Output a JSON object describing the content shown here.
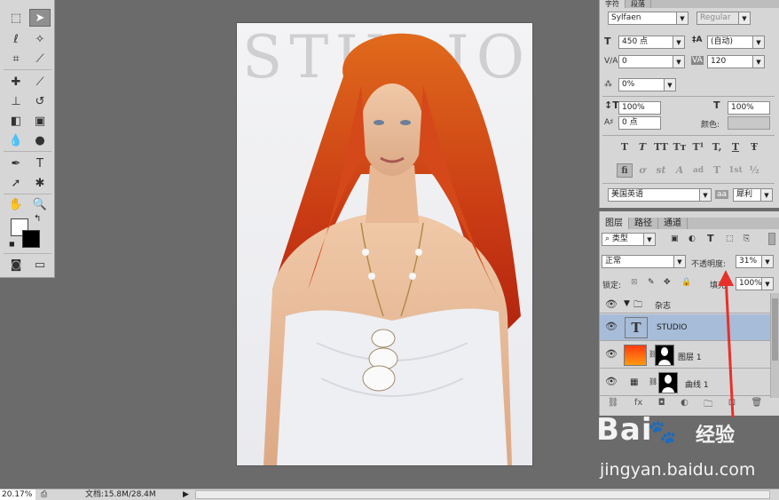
{
  "toolbox": {
    "tools": [
      "marquee-tool",
      "move-tool",
      "lasso-tool",
      "quick-select-tool",
      "crop-tool",
      "eyedropper-tool",
      "healing-tool",
      "brush-tool",
      "stamp-tool",
      "history-brush-tool",
      "eraser-tool",
      "gradient-tool",
      "blur-tool",
      "dodge-tool",
      "pen-tool",
      "type-tool",
      "path-select-tool",
      "shape-tool",
      "hand-tool",
      "zoom-tool"
    ],
    "active_tool": "move-tool",
    "foreground_color": "#ffffff",
    "background_color": "#000000"
  },
  "document": {
    "watermark_text": "STUDIO"
  },
  "character_panel": {
    "tabs": [
      "字符",
      "段落"
    ],
    "font_family": "Sylfaen",
    "font_style": "Regular",
    "font_size": "450 点",
    "leading": "(自动)",
    "kerning": "0",
    "tracking": "120",
    "tsume": "0%",
    "vertical_scale": "100%",
    "horizontal_scale": "100%",
    "baseline_shift": "0 点",
    "color_label": "颜色:",
    "style_buttons": [
      "T",
      "T",
      "TT",
      "Tт",
      "T¹",
      "T,",
      "T",
      "Ŧ"
    ],
    "opentype_buttons": [
      "fi",
      "ơ",
      "st",
      "A",
      "ad",
      "T",
      "1st",
      "½"
    ],
    "language": "美国英语",
    "aa_icon": "aa",
    "antialias": "犀利"
  },
  "layers_panel": {
    "tabs": [
      "图层",
      "路径",
      "通道"
    ],
    "filter_kind": "类型",
    "blend_mode": "正常",
    "opacity_label": "不透明度:",
    "opacity_value": "31%",
    "lock_label": "锁定:",
    "fill_label": "填充:",
    "fill_value": "100%",
    "group_name": "杂志",
    "layers": [
      {
        "name": "STUDIO",
        "type": "text",
        "selected": true
      },
      {
        "name": "图层 1",
        "type": "masked-gradient",
        "selected": false
      },
      {
        "name": "曲线 1",
        "type": "adjustment",
        "selected": false
      }
    ]
  },
  "statusbar": {
    "zoom": "20.17%",
    "doc_size": "文档:15.8M/28.4M"
  },
  "watermark": {
    "logo": "Bai",
    "logo_suffix": "经验",
    "url": "jingyan.baidu.com"
  },
  "colors": {
    "accent_selection": "#a7bcd9",
    "annotation_red": "#e8302a",
    "hair": "#d8461a"
  }
}
